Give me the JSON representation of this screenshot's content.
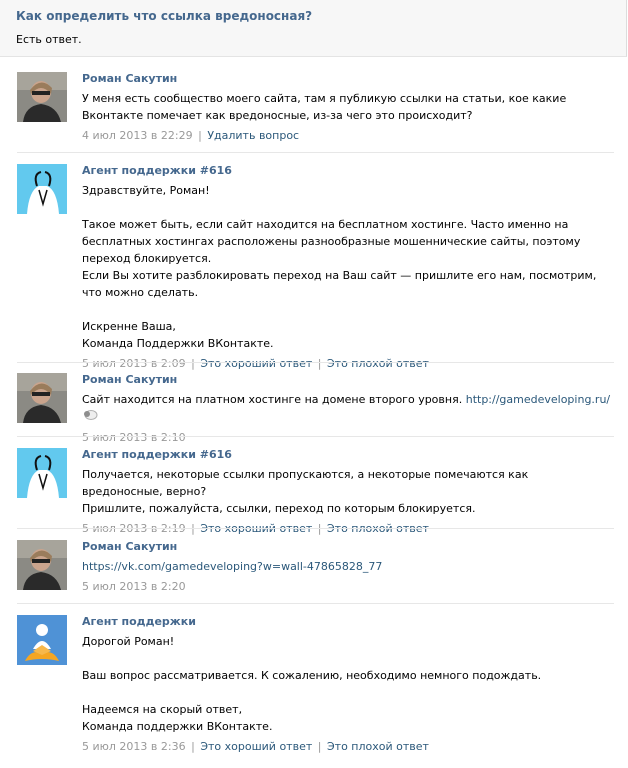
{
  "question": {
    "title": "Как определить что ссылка вредоносная?",
    "status": "Есть ответ."
  },
  "messages": [
    {
      "author": "Роман Сакутин",
      "lines": [
        "У меня есть сообщество моего сайта, там я публикую ссылки на статьи, кое какие Вконтакте помечает как вредоносные, из-за чего это происходит?"
      ],
      "date": "4 июл 2013 в 22:29",
      "action": "Удалить вопрос"
    },
    {
      "author": "Агент поддержки #616",
      "p1": "Здравствуйте, Роман!",
      "p2": "Такое может быть, если сайт находится на бесплатном хостинге. Часто именно на бесплатных хостингах расположены разнообразные мошеннические сайты, поэтому переход блокируется.",
      "p3": "Если Вы хотите разблокировать переход на Ваш сайт — пришлите его нам, посмотрим, что можно сделать.",
      "p4": "Искренне Ваша,",
      "p5": "Команда Поддержки ВКонтакте.",
      "date": "5 июл 2013 в 2:09",
      "good": "Это хороший ответ",
      "bad": "Это плохой ответ"
    },
    {
      "author": "Роман Сакутин",
      "text": "Сайт находится на платном хостинге на домене второго уровня.",
      "link": "http://gamedeveloping.ru/",
      "date": "5 июл 2013 в 2:10"
    },
    {
      "author": "Агент поддержки #616",
      "p1": "Получается, некоторые ссылки пропускаются, а некоторые помечаются как вредоносные, верно?",
      "p2": "Пришлите, пожалуйста, ссылки, переход по которым блокируется.",
      "date": "5 июл 2013 в 2:19",
      "good": "Это хороший ответ",
      "bad": "Это плохой ответ"
    },
    {
      "author": "Роман Сакутин",
      "link": "https://vk.com/gamedeveloping?w=wall-47865828_77",
      "date": "5 июл 2013 в 2:20"
    },
    {
      "author": "Агент поддержки",
      "p1": "Дорогой Роман!",
      "p2": "Ваш вопрос рассматривается. К сожалению, необходимо немного подождать.",
      "p3": "Надеемся на скорый ответ,",
      "p4": "Команда поддержки ВКонтакте.",
      "date": "5 июл 2013 в 2:36",
      "good": "Это хороший ответ",
      "bad": "Это плохой ответ"
    }
  ],
  "colors": {
    "link": "#2b587a",
    "author": "#45688e",
    "meta": "#999999",
    "divider": "#e7e7e7"
  }
}
